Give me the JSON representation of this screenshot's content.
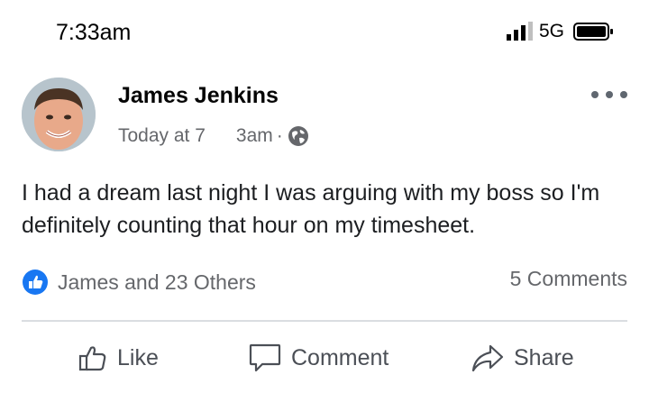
{
  "status_bar": {
    "time": "7:33am",
    "network": "5G",
    "icons": [
      "signal-bars-icon",
      "battery-icon"
    ]
  },
  "post": {
    "author": "James Jenkins",
    "time_part1": "Today at 7",
    "time_part2": "3am",
    "separator": "·",
    "privacy_icon": "globe-icon",
    "text": "I had a dream last night I was arguing with my boss so I'm definitely counting that hour on my timesheet.",
    "reactions_label": "James and 23 Others",
    "comments_label": "5 Comments"
  },
  "actions": {
    "like": "Like",
    "comment": "Comment",
    "share": "Share"
  },
  "colors": {
    "accent": "#1877f2",
    "secondary_text": "#65676b",
    "divider": "#dadde1"
  }
}
